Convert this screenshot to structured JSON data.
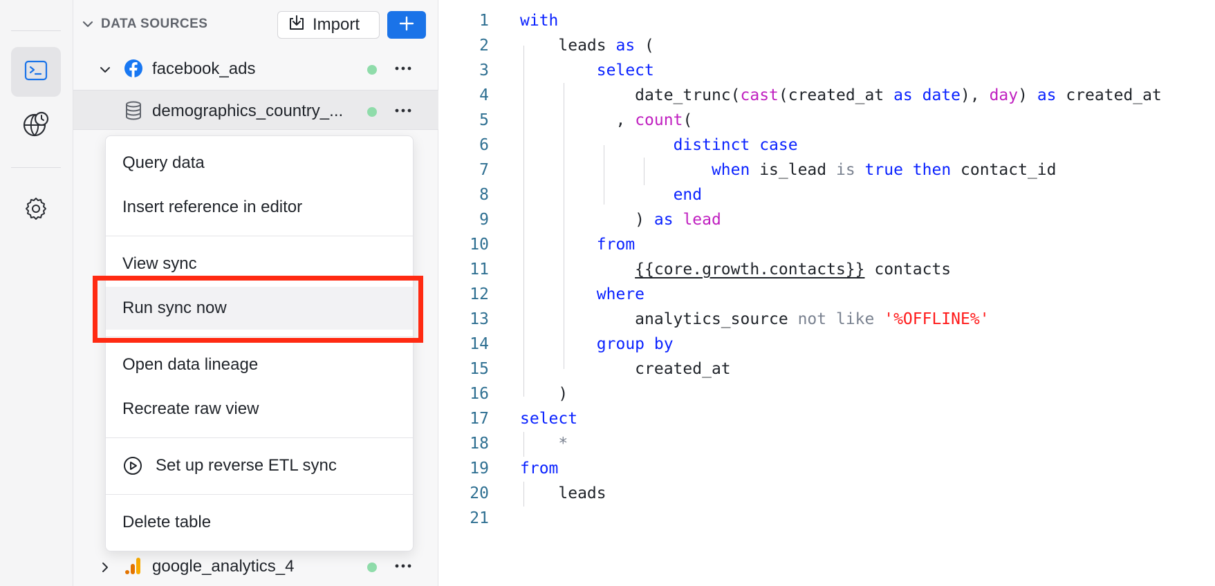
{
  "sidebar": {
    "section_title": "DATA SOURCES",
    "import_label": "Import",
    "rows": [
      {
        "label": "facebook_ads",
        "icon": "facebook-icon"
      },
      {
        "label": "demographics_country_...",
        "icon": "database-icon"
      },
      {
        "label": "google_analytics_4",
        "icon": "google-analytics-icon"
      }
    ]
  },
  "menu": {
    "items": [
      "Query data",
      "Insert reference in editor",
      "View sync",
      "Run sync now",
      "Open data lineage",
      "Recreate raw view",
      "Set up reverse ETL sync",
      "Delete table"
    ]
  },
  "editor": {
    "line_numbers": [
      "1",
      "2",
      "3",
      "4",
      "5",
      "6",
      "7",
      "8",
      "9",
      "10",
      "11",
      "12",
      "13",
      "14",
      "15",
      "16",
      "17",
      "18",
      "19",
      "20",
      "21"
    ],
    "tokens": {
      "with": "with",
      "leads_as_open": "leads ",
      "as": "as",
      "paren_open": " (",
      "select": "select",
      "date_trunc": "date_trunc(",
      "cast": "cast",
      "created_at_arg": "(created_at ",
      "date": "date",
      "comma_space": "), ",
      "day": "day",
      "close_paren_space": ") ",
      "created_at_alias": " created_at",
      "comma_lead": ", ",
      "count": "count",
      "open_paren": "(",
      "distinct": "distinct",
      "case": "case",
      "when": "when",
      "is_lead": " is_lead ",
      "is": "is",
      "true": "true",
      "then": "then",
      "contact_id": " contact_id",
      "end": "end",
      "close_paren": ") ",
      "lead": "lead",
      "from": "from",
      "ref": "{{core.growth.contacts}}",
      "contacts": " contacts",
      "where": "where",
      "analytics_source": "analytics_source ",
      "not_like": "not like",
      "offline": "'%OFFLINE%'",
      "group_by": "group by",
      "created_at": "created_at",
      "close": ")",
      "star": "*",
      "leads": "leads"
    }
  },
  "colors": {
    "keyword": "#0a22ff",
    "function": "#c020c0",
    "operator": "#7a8290",
    "string": "#ff1a1a",
    "accent": "#1a73e8",
    "highlight": "#ff2a12"
  }
}
